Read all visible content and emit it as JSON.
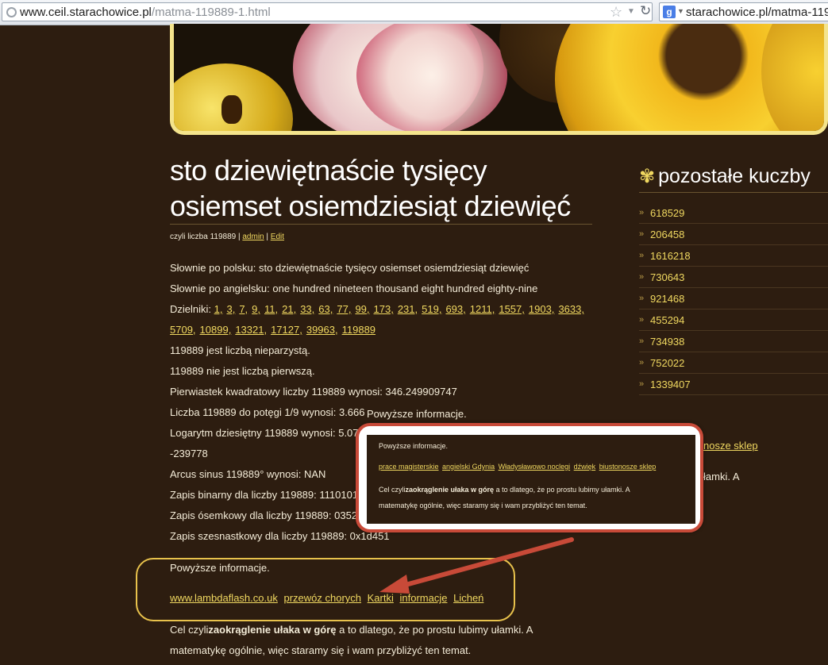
{
  "browser": {
    "url_domain": "www.ceil.starachowice.pl",
    "url_path": "/matma-119889-1.html",
    "search_text": "starachowice.pl/matma-119"
  },
  "article": {
    "title_line1": "sto dziewiętnaście tysięcy",
    "title_line2": "osiemset osiemdziesiąt dziewięć",
    "meta_prefix": "czyli liczba 119889 |",
    "meta_admin": "admin",
    "meta_sep": "|",
    "meta_edit": "Edit",
    "slownie_pl": "Słownie po polsku: sto dziewiętnaście tysięcy osiemset osiemdziesiąt dziewięć",
    "slownie_en": "Słownie po angielsku: one hundred nineteen thousand eight hundred eighty-nine",
    "dzielniki_label": "Dzielniki:",
    "divisors_row1": [
      "1",
      "3",
      "7",
      "9",
      "11",
      "21",
      "33",
      "63",
      "77",
      "99",
      "173",
      "231",
      "519",
      "693",
      "1211",
      "1557",
      "1903",
      "3633"
    ],
    "divisors_row2": [
      "5709",
      "10899",
      "13321",
      "17127",
      "39963",
      "119889"
    ],
    "nieparzysta": "119889 jest liczbą nieparzystą.",
    "pierwsza": "119889 nie jest liczbą pierwszą.",
    "pierwiastek": "Pierwiastek kwadratowy liczby 119889 wynosi: 346.249909747",
    "potega": "Liczba 119889 do potęgi 1/9 wynosi: 3.666",
    "logarytm": "Logarytm dziesiętny 119889 wynosi: 5.07",
    "minus": "-239778",
    "arcus": "Arcus sinus 119889° wynosi: NAN",
    "binarny": "Zapis binarny dla liczby 119889: 1110101",
    "osemkowy": "Zapis ósemkowy dla liczby 119889: 0352",
    "szesnastkowy": "Zapis szesnastkowy dla liczby 119889: 0x1d451",
    "powyzsze": "Powyższe informacje.",
    "links": [
      "www.lambdaflash.co.uk",
      "przewóz chorych",
      "Kartki",
      "informacje",
      "Licheń"
    ],
    "cel_prefix": "Cel czyli",
    "cel_bold": "zaokrąglenie ułaka w górę",
    "cel_suffix": " a to dlatego, że po prostu lubimy ułamki. A",
    "cel_line2": "matematykę ogólnie, więc staramy się i wam przybliżyć ten temat."
  },
  "sidebar": {
    "title": "pozostałe kuczby",
    "items": [
      "618529",
      "206458",
      "1616218",
      "730643",
      "921468",
      "455294",
      "734938",
      "752022",
      "1339407"
    ],
    "partial_link": "nosze sklep",
    "partial_text": "łamki. A"
  },
  "tooltip": {
    "text": "Powyższe informacje."
  },
  "popup": {
    "intro": "Powyższe informacje.",
    "links": [
      "prace magisterskie",
      "angielski Gdynia",
      "Władysławowo noclegi",
      "dźwięk",
      "biustonosze sklep"
    ],
    "body_prefix": "Cel czyli",
    "body_bold": "zaokrąglenie ułaka w górę",
    "body_suffix": " a to dlatego, że po prostu lubimy ułamki. A",
    "body_line2": "matematykę ogólnie, więc staramy się i wam przybliżyć ten temat."
  },
  "colors": {
    "background": "#2d1d10",
    "link": "#f0d860",
    "header_border": "#f4e48c",
    "highlight": "#e8c24c",
    "popup_border": "#c84a38",
    "arrow": "#c84a38"
  }
}
